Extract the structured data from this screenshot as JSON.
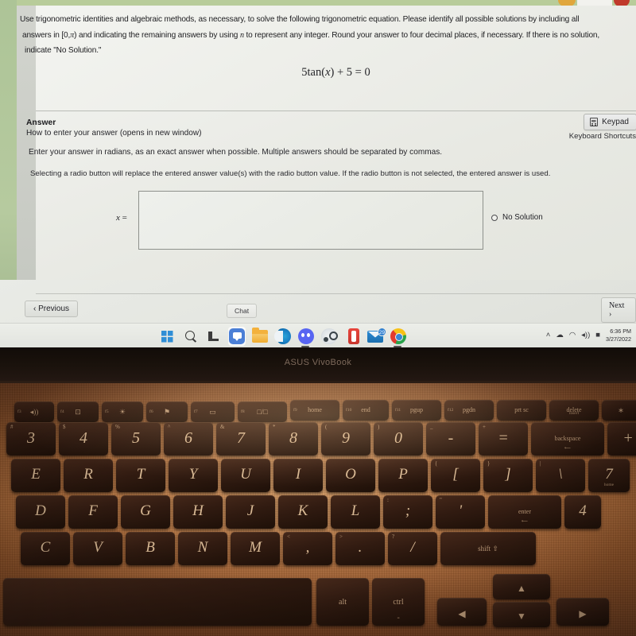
{
  "question": {
    "line1": "Use trigonometric identities and algebraic methods, as necessary, to solve the following trigonometric equation. Please identify all possible solutions by including all",
    "line2_a": "answers in [0,",
    "line2_pi": "π",
    "line2_b": ") and indicating the remaining answers by using",
    "line2_n": "n",
    "line2_c": "to represent any integer. Round your answer to four decimal places, if necessary. If there is no solution,",
    "line3": "indicate \"No Solution.\"",
    "equation_lhs": "5tan(",
    "equation_var": "x",
    "equation_rhs": ") + 5 = 0"
  },
  "answer": {
    "title": "Answer",
    "how_link": "How to enter your answer (opens in new window)",
    "instruction_1": "Enter your answer in radians, as an exact answer when possible. Multiple answers should be separated by commas.",
    "instruction_2": "Selecting a radio button will replace the entered answer value(s) with the radio button value. If the radio button is not selected, the entered answer is used.",
    "x_label": "x",
    "x_equals": "=",
    "input_value": "",
    "input_placeholder": "",
    "radio_label": "No Solution",
    "radio_selected": false,
    "keypad_button": "Keypad",
    "keypad_icon": "calculator-icon",
    "keyboard_shortcuts": "Keyboard Shortcuts"
  },
  "nav": {
    "previous": "‹ Previous",
    "chat": "Chat",
    "next": "Next ›"
  },
  "taskbar": {
    "icons": [
      {
        "name": "windows-start-icon",
        "class": "ico-win",
        "active": false,
        "running": false,
        "badge": ""
      },
      {
        "name": "search-icon",
        "class": "ico-search",
        "active": false,
        "running": false,
        "badge": ""
      },
      {
        "name": "task-view-icon",
        "class": "ico-task",
        "active": false,
        "running": false,
        "badge": ""
      },
      {
        "name": "chat-teams-icon",
        "class": "ico-chat",
        "active": true,
        "running": false,
        "badge": ""
      },
      {
        "name": "file-explorer-icon",
        "class": "ico-folder",
        "active": false,
        "running": false,
        "badge": ""
      },
      {
        "name": "microsoft-edge-icon",
        "class": "ico-edge",
        "active": false,
        "running": false,
        "badge": ""
      },
      {
        "name": "discord-icon",
        "class": "ico-discord",
        "active": false,
        "running": true,
        "badge": ""
      },
      {
        "name": "steam-icon",
        "class": "ico-steam",
        "active": false,
        "running": false,
        "badge": ""
      },
      {
        "name": "office-icon",
        "class": "ico-office",
        "active": false,
        "running": false,
        "badge": ""
      },
      {
        "name": "mail-icon",
        "class": "ico-mail",
        "active": false,
        "running": false,
        "badge": "29"
      },
      {
        "name": "google-chrome-icon",
        "class": "ico-chrome",
        "active": false,
        "running": true,
        "badge": ""
      }
    ],
    "tray": {
      "chevron": "˄",
      "onedrive": "☁",
      "wifi": "◠",
      "volume": "◂))",
      "battery": "■",
      "time": "6:36 PM",
      "date": "3/27/2022"
    }
  },
  "laptop": {
    "brand": "ASUS VivoBook"
  },
  "keyboard": {
    "fn_row": [
      {
        "num": "f3",
        "glyph": "◂))",
        "label": ""
      },
      {
        "num": "f4",
        "glyph": "⊡",
        "label": ""
      },
      {
        "num": "f5",
        "glyph": "☀",
        "label": ""
      },
      {
        "num": "f6",
        "glyph": "⚑",
        "label": ""
      },
      {
        "num": "f7",
        "glyph": "▭",
        "label": ""
      },
      {
        "num": "f8",
        "glyph": "□/□",
        "label": ""
      },
      {
        "num": "f9",
        "glyph": "",
        "label": "home"
      },
      {
        "num": "f10",
        "glyph": "",
        "label": "end"
      },
      {
        "num": "f11",
        "glyph": "",
        "label": "pgup"
      },
      {
        "num": "f12",
        "glyph": "",
        "label": "pgdn"
      },
      {
        "num": "",
        "glyph": "",
        "label": "prt sc"
      },
      {
        "num": "",
        "glyph": "",
        "label": "delete"
      },
      {
        "num": "",
        "glyph": "∗",
        "label": ""
      },
      {
        "num": "",
        "glyph": "/",
        "label": ""
      }
    ],
    "num_row": [
      {
        "top": "#",
        "main": "3"
      },
      {
        "top": "$",
        "main": "4"
      },
      {
        "top": "%",
        "main": "5"
      },
      {
        "top": "^",
        "main": "6"
      },
      {
        "top": "&",
        "main": "7"
      },
      {
        "top": "*",
        "main": "8"
      },
      {
        "top": "(",
        "main": "9"
      },
      {
        "top": ")",
        "main": "0"
      },
      {
        "top": "_",
        "main": "-"
      },
      {
        "top": "+",
        "main": "="
      },
      {
        "top": "",
        "main": "backspace"
      },
      {
        "top": "",
        "main": "+"
      },
      {
        "top": "",
        "main": "−"
      }
    ],
    "qwerty_row": [
      {
        "top": "",
        "main": "E"
      },
      {
        "top": "",
        "main": "R"
      },
      {
        "top": "",
        "main": "T"
      },
      {
        "top": "",
        "main": "Y"
      },
      {
        "top": "",
        "main": "U"
      },
      {
        "top": "",
        "main": "I"
      },
      {
        "top": "",
        "main": "O"
      },
      {
        "top": "",
        "main": "P"
      },
      {
        "top": "{",
        "main": "["
      },
      {
        "top": "}",
        "main": "]"
      },
      {
        "top": "|",
        "main": "\\"
      },
      {
        "top": "",
        "main": "7"
      }
    ],
    "home_row": [
      {
        "top": "",
        "main": "D"
      },
      {
        "top": "",
        "main": "F"
      },
      {
        "top": "",
        "main": "G"
      },
      {
        "top": "",
        "main": "H"
      },
      {
        "top": "",
        "main": "J"
      },
      {
        "top": "",
        "main": "K"
      },
      {
        "top": "",
        "main": "L"
      },
      {
        "top": ":",
        "main": ";"
      },
      {
        "top": "\"",
        "main": "'"
      },
      {
        "top": "",
        "main": "enter"
      },
      {
        "top": "",
        "main": "4"
      }
    ],
    "bottom_row": [
      {
        "top": "",
        "main": "C"
      },
      {
        "top": "",
        "main": "V"
      },
      {
        "top": "",
        "main": "B"
      },
      {
        "top": "",
        "main": "N"
      },
      {
        "top": "",
        "main": "M"
      },
      {
        "top": "<",
        "main": ","
      },
      {
        "top": ">",
        "main": "."
      },
      {
        "top": "?",
        "main": "/"
      },
      {
        "top": "",
        "main": "shift ⇧"
      }
    ],
    "space_row": [
      {
        "main": ""
      },
      {
        "main": "alt"
      },
      {
        "main": "ctrl"
      },
      {
        "main": "◀"
      },
      {
        "main": "▲"
      },
      {
        "main": "▼"
      },
      {
        "main": "▶"
      }
    ],
    "key_sublabels": {
      "seven_home": "home",
      "delete_insert": "insert"
    }
  }
}
